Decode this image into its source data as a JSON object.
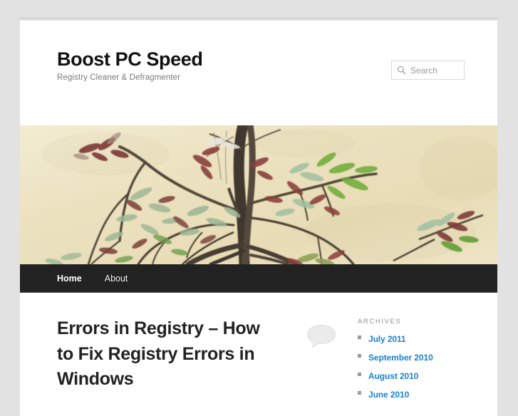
{
  "site": {
    "title": "Boost PC Speed",
    "description": "Registry Cleaner & Defragmenter"
  },
  "search": {
    "placeholder": "Search",
    "value": "",
    "icon": "search-icon"
  },
  "header_image": {
    "alt": "Bonsai tree branches with green and red leaves against a cream wall",
    "colors": {
      "wall": "#ece3c4",
      "wall_light": "#f2ecd4",
      "branch": "#4a4238",
      "leaf_green": "#7fbf3f",
      "leaf_red": "#8d3b3b",
      "leaf_pale": "#b9c8b0"
    }
  },
  "nav": {
    "items": [
      {
        "label": "Home",
        "current": true
      },
      {
        "label": "About",
        "current": false
      }
    ]
  },
  "post": {
    "title": "Errors in Registry – How to Fix Registry Errors in Windows",
    "comments_bubble": "comment-bubble-icon",
    "comments_count": ""
  },
  "sidebar": {
    "widgets": [
      {
        "title": "Archives",
        "items": [
          {
            "label": "July 2011"
          },
          {
            "label": "September 2010"
          },
          {
            "label": "August 2010"
          },
          {
            "label": "June 2010"
          }
        ]
      }
    ]
  },
  "colors": {
    "page_background": "#e2e2e2",
    "content_background": "#ffffff",
    "nav_background": "#222222",
    "link_blue": "#1982d1",
    "title_dark": "#111111",
    "muted_gray": "#7a7a7a"
  }
}
